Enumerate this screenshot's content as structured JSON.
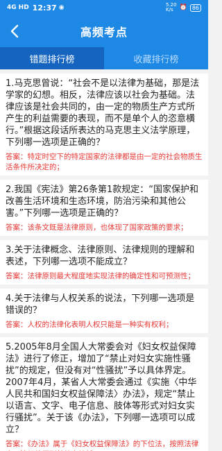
{
  "status": {
    "signal1": "4G",
    "signal2": "HD",
    "time": "12:37",
    "speed": "5.20\nK/s",
    "battery": "86"
  },
  "header": {
    "title": "高频考点"
  },
  "tabs": [
    {
      "label": "错题排行榜",
      "active": true
    },
    {
      "label": "收藏排行榜",
      "active": false
    }
  ],
  "questions": [
    {
      "text": "1.马克思曾说：“社会不是以法律为基础，那是法学家的幻想。相反，法律应该以社会为基础。法律应该是社会共同的，由一定的物质生产方式所产生的利益需要的表现，而不是单个人的恣意横行。”根据这段话所表达的马克思主义法学原理，下列哪一选项是正确的？",
      "answer": "答案：特定时空下的特定国家的法律都是由一定的社会物质生活条件所决定的；"
    },
    {
      "text": "2.我国《宪法》第26条第1款规定：“国家保护和改善生活环境和生态环境，防治污染和其他公害。”下列哪一选项是正确的？",
      "answer": "答案：该条文既是法律原则，也体现了国家政策的要求；"
    },
    {
      "text": "3.关于法律概念、法律原则、法律规则的理解和表述，下列哪一选项不能成立？",
      "answer": "答案：法律原则最大程度地实现法律的确定性和可预测性；"
    },
    {
      "text": "4.关于法律与人权关系的说法，下列哪一选项是错误的？",
      "answer": "答案：人权的法律化表明人权只能是一种实有权利；"
    },
    {
      "text": "5.2005年8月全国人大常委会对《妇女权益保障法》进行了修正，增加了“禁止对妇女实施性骚扰”的规定，但没有对“性骚扰”予以具体界定。2007年4月，某省人大常委会通过《实施〈中华人民共和国妇女权益保障法〉办法》，规定“禁止以语言、文字、电子信息、肢体等形式对妇女实行骚扰”。关于该《办法》，下列哪一选项可以成立？",
      "answer": "答案：《办法》属于《妇女权益保障法》的下位法，按照法律高于法规的原则其效力较低；"
    }
  ]
}
